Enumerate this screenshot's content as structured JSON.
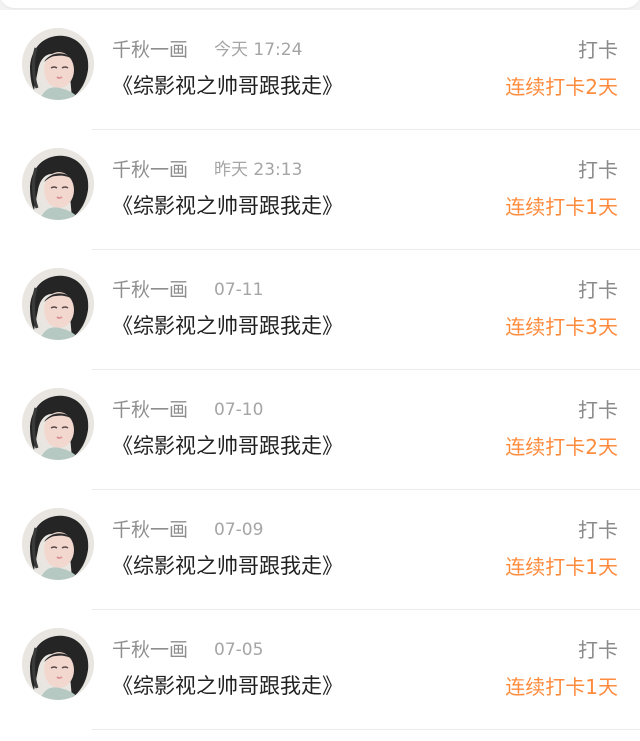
{
  "checkins": [
    {
      "user": "千秋一画",
      "time": "今天 17:24",
      "title": "《综影视之帅哥跟我走》",
      "action": "打卡",
      "streak": "连续打卡2天"
    },
    {
      "user": "千秋一画",
      "time": "昨天 23:13",
      "title": "《综影视之帅哥跟我走》",
      "action": "打卡",
      "streak": "连续打卡1天"
    },
    {
      "user": "千秋一画",
      "time": "07-11",
      "title": "《综影视之帅哥跟我走》",
      "action": "打卡",
      "streak": "连续打卡3天"
    },
    {
      "user": "千秋一画",
      "time": "07-10",
      "title": "《综影视之帅哥跟我走》",
      "action": "打卡",
      "streak": "连续打卡2天"
    },
    {
      "user": "千秋一画",
      "time": "07-09",
      "title": "《综影视之帅哥跟我走》",
      "action": "打卡",
      "streak": "连续打卡1天"
    },
    {
      "user": "千秋一画",
      "time": "07-05",
      "title": "《综影视之帅哥跟我走》",
      "action": "打卡",
      "streak": "连续打卡1天"
    }
  ],
  "colors": {
    "accent": "#ff8b3d",
    "name_gray": "#8e8e8e",
    "time_gray": "#a5a5a5",
    "title_text": "#222222",
    "divider": "#ececec"
  },
  "icons": {
    "avatar": "user-avatar-illustration"
  }
}
